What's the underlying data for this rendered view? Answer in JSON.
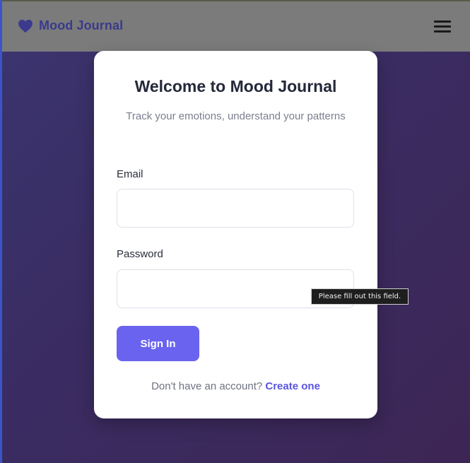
{
  "navbar": {
    "brand_icon": "heart-icon",
    "brand_name": "Mood Journal",
    "menu_icon": "hamburger-menu-icon"
  },
  "login_card": {
    "title": "Welcome to Mood Journal",
    "subtitle": "Track your emotions, understand your patterns",
    "email": {
      "label": "Email",
      "value": "",
      "placeholder": ""
    },
    "password": {
      "label": "Password",
      "value": "",
      "placeholder": ""
    },
    "submit_label": "Sign In",
    "signup_prompt": "Don't have an account?",
    "signup_link": "Create one"
  },
  "validation_tooltip": {
    "text": "Please fill out this field."
  },
  "colors": {
    "brand": "#3b3a8c",
    "primary_button": "#6a63f0",
    "link": "#5a54e0",
    "navbar_bg": "#7b7b7b",
    "background_start": "#3b3570",
    "background_end": "#3d2655"
  }
}
